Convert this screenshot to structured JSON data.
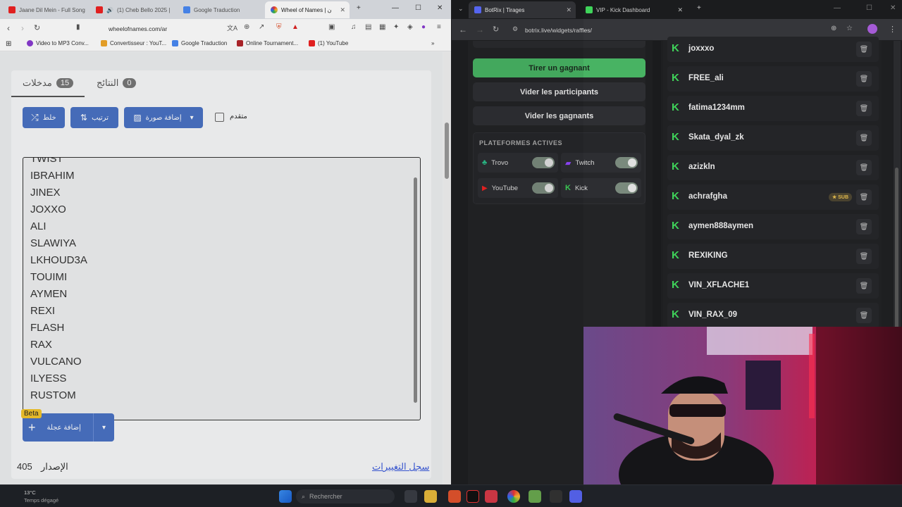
{
  "left_browser": {
    "tabs": [
      {
        "title": "Jaane Dil Mein - Full Song",
        "favicon": "youtube-icon",
        "color": "#e22"
      },
      {
        "title": "(1) Cheb Bello 2025 |",
        "favicon": "youtube-icon",
        "color": "#e22"
      },
      {
        "title": "Google Traduction",
        "favicon": "translate-icon",
        "color": "#4a8af4"
      },
      {
        "title": "Wheel of Names | ن",
        "favicon": "wheel-icon",
        "color": "#3b9c4a"
      }
    ],
    "new_tab": "+",
    "url": "wheelofnames.com/ar",
    "bookmarks": [
      {
        "label": "Video to MP3 Conv...",
        "color": "#8a3bd1"
      },
      {
        "label": "Convertisseur : YouT...",
        "color": "#f1a72a"
      },
      {
        "label": "Google Traduction",
        "color": "#4a8af4"
      },
      {
        "label": "Online Tournament...",
        "color": "#b3262b"
      },
      {
        "label": "(1) YouTube",
        "color": "#e22"
      }
    ]
  },
  "wheel": {
    "tab_entries": "مدخلات",
    "tab_entries_count": "15",
    "tab_results": "النتائج",
    "tab_results_count": "0",
    "shuffle": "خلط",
    "sort": "ترتيب",
    "add_image": "إضافة صورة",
    "advanced": "متقدم",
    "entries": [
      "TWIST",
      "IBRAHIM",
      "JINEX",
      "JOXXO",
      "ALI",
      "SLAWIYA",
      "LKHOUD3A",
      "TOUIMI",
      "AYMEN",
      "REXI",
      "FLASH",
      "RAX",
      "VULCANO",
      "ILYESS",
      "RUSTOM"
    ],
    "beta": "Beta",
    "add_wheel": "إضافة عجلة",
    "version_label": "الإصدار",
    "version_number": "405",
    "changelog": "سجل التغييرات"
  },
  "right_browser": {
    "tabs": [
      {
        "title": "BotRix | Tirages",
        "color": "#5b6cff"
      },
      {
        "title": "VIP - Kick Dashboard",
        "color": "#3fd45a"
      }
    ],
    "url": "botrix.live/widgets/raffles/"
  },
  "botrix": {
    "draw_winner": "Tirer un gagnant",
    "clear_participants": "Vider les participants",
    "clear_winners": "Vider les gagnants",
    "platforms_title": "PLATEFORMES ACTIVES",
    "platforms": [
      {
        "name": "Trovo",
        "color": "#2bbf8b",
        "enabled": true
      },
      {
        "name": "Twitch",
        "color": "#9146ff",
        "enabled": true
      },
      {
        "name": "YouTube",
        "color": "#e22",
        "enabled": true
      },
      {
        "name": "Kick",
        "color": "#3fd45a",
        "enabled": true
      }
    ],
    "participants": [
      {
        "name": "joxxxo"
      },
      {
        "name": "FREE_ali"
      },
      {
        "name": "fatima1234mm"
      },
      {
        "name": "Skata_dyal_zk"
      },
      {
        "name": "azizkln"
      },
      {
        "name": "achrafgha",
        "badge": "SUB"
      },
      {
        "name": "aymen888aymen"
      },
      {
        "name": "REXIKING"
      },
      {
        "name": "VIN_XFLACHE1"
      },
      {
        "name": "VIN_RAX_09"
      }
    ]
  },
  "taskbar": {
    "temperature": "13°C",
    "weather": "Temps dégagé",
    "search_placeholder": "Rechercher"
  }
}
